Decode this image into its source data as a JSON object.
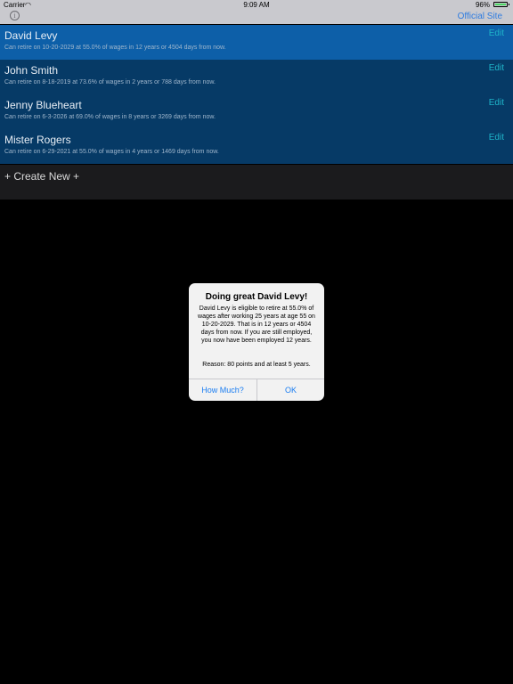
{
  "status_bar": {
    "carrier": "Carrier",
    "time": "9:09 AM",
    "battery": "96%",
    "battery_level": 0.96,
    "icons": [
      "wifi-icon",
      "battery-icon"
    ]
  },
  "nav": {
    "info_icon": "info-icon",
    "official_site": "Official Site"
  },
  "people": [
    {
      "name": "David Levy",
      "detail": "Can retire on 10-20-2029 at 55.0% of wages in 12 years or 4504 days from now.",
      "edit": "Edit"
    },
    {
      "name": "John Smith",
      "detail": "Can retire on 8-18-2019 at 73.6% of wages in 2 years or 788 days from now.",
      "edit": "Edit"
    },
    {
      "name": "Jenny Blueheart",
      "detail": "Can retire on 6-3-2026 at 69.0% of wages in 8 years or 3269 days from now.",
      "edit": "Edit"
    },
    {
      "name": "Mister Rogers",
      "detail": "Can retire on 6-29-2021 at 55.0% of wages in 4 years or 1469 days from now.",
      "edit": "Edit"
    }
  ],
  "create_new": "+ Create New +",
  "alert": {
    "title": "Doing great David Levy!",
    "message": "David Levy is eligible to retire at 55.0% of wages after working 25 years at age 55 on 10-20-2029. That is in 12 years or 4504 days from now. If you are still employed, you now have been employed 12 years.",
    "reason": "Reason: 80 points and at least 5 years.",
    "how_much": "How Much?",
    "ok": "OK"
  },
  "colors": {
    "selected_row": "#0d5fa8",
    "row": "#063a66",
    "edit": "#1fb4c9",
    "link": "#2e7ce0",
    "alert_button": "#1a7df2"
  }
}
